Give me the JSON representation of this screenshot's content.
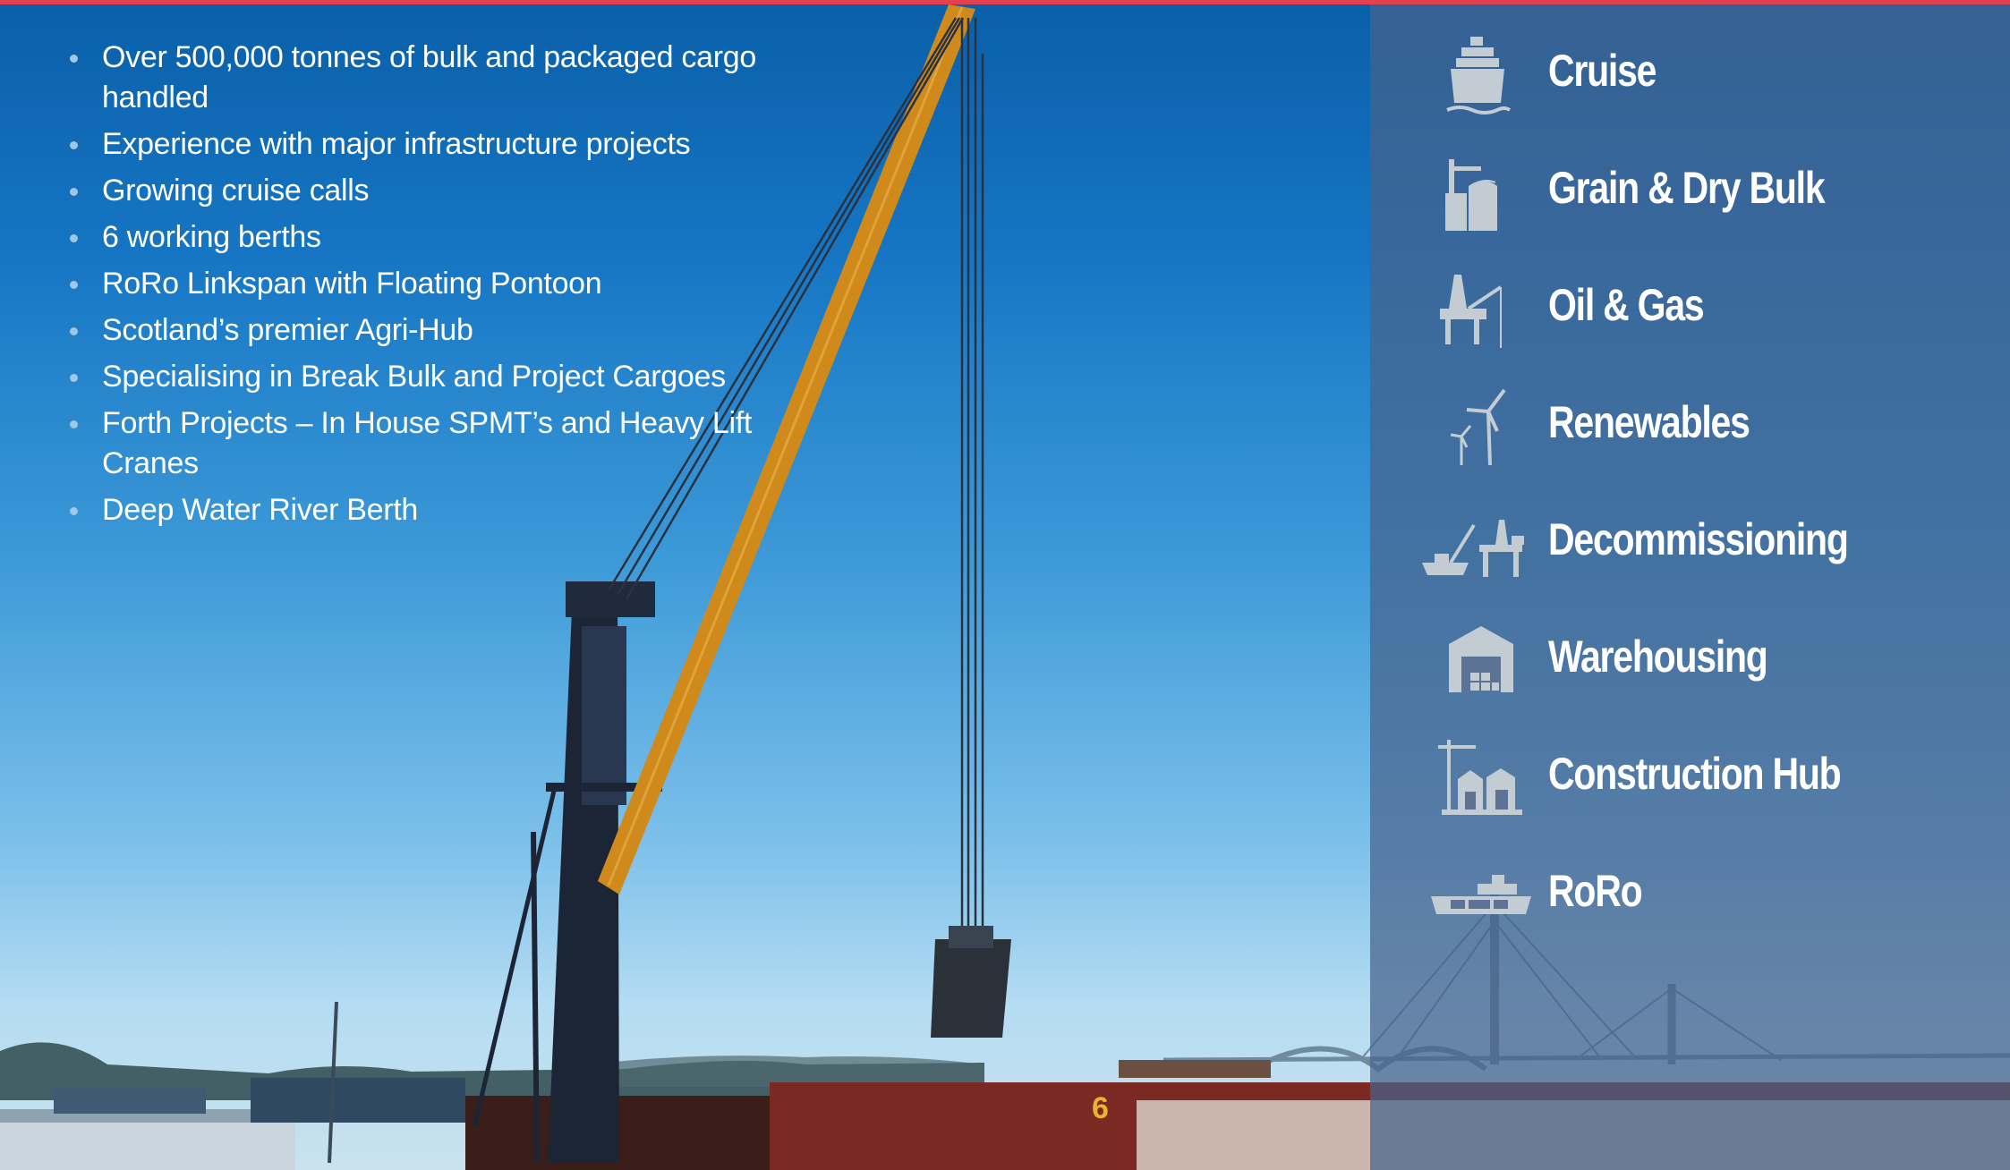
{
  "colors": {
    "accent_bar": "#e2404e",
    "panel": "#46628c",
    "icon": "#c4ccd3",
    "text": "#ffffff"
  },
  "features": [
    "Over 500,000 tonnes of bulk and packaged cargo handled",
    "Experience with major infrastructure projects",
    "Growing cruise calls",
    "6 working berths",
    "RoRo Linkspan with Floating Pontoon",
    "Scotland’s premier Agri-Hub",
    "Specialising in Break Bulk and Project Cargoes",
    "Forth Projects – In House SPMT’s and Heavy Lift Cranes",
    "Deep Water River Berth"
  ],
  "sectors": [
    {
      "label": "Cruise",
      "icon": "cruise-ship-icon"
    },
    {
      "label": "Grain & Dry Bulk",
      "icon": "grain-silo-icon"
    },
    {
      "label": "Oil & Gas",
      "icon": "oil-rig-icon"
    },
    {
      "label": "Renewables",
      "icon": "wind-turbine-icon"
    },
    {
      "label": "Decommissioning",
      "icon": "decommissioning-icon"
    },
    {
      "label": "Warehousing",
      "icon": "warehouse-icon"
    },
    {
      "label": "Construction Hub",
      "icon": "construction-icon"
    },
    {
      "label": "RoRo",
      "icon": "roro-ferry-icon"
    }
  ],
  "scene": {
    "berth_number": "6"
  }
}
